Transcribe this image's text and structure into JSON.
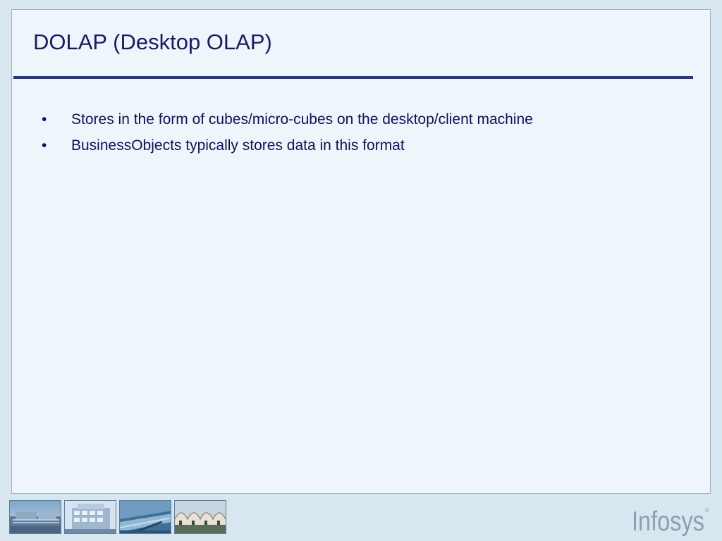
{
  "slide": {
    "title": "DOLAP (Desktop OLAP)",
    "bullets": [
      {
        "glyph": "•",
        "text": "Stores in the form of cubes/micro-cubes on the desktop/client machine"
      },
      {
        "glyph": "•",
        "text": "BusinessObjects typically stores data in this format"
      }
    ]
  },
  "footer": {
    "photo_icons": [
      "campus-building-photo-icon",
      "glass-building-photo-icon",
      "atrium-photo-icon",
      "arched-roof-photo-icon"
    ],
    "logo_text": "Infosys",
    "logo_mark": "®"
  },
  "colors": {
    "background": "#d8e6f0",
    "slide_background": "#eff6fb",
    "title": "#1a1a64",
    "title_rule": "#27348b",
    "bullet_text": "#10105a",
    "logo": "#8aa0b4"
  }
}
